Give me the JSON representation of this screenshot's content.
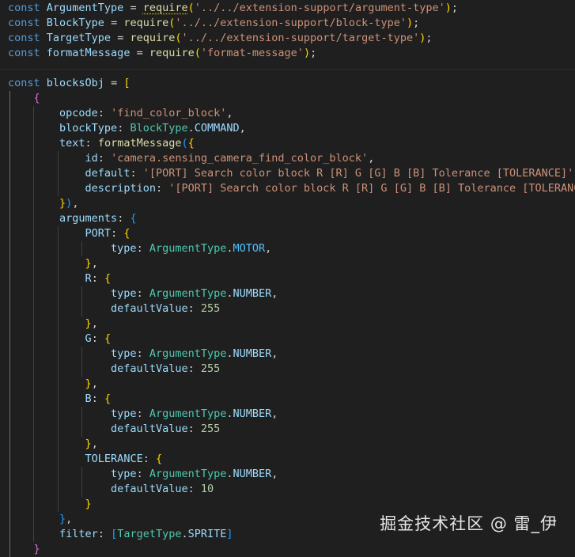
{
  "lines": [
    [
      [
        "kw",
        "const "
      ],
      [
        "var",
        "ArgumentType"
      ],
      [
        "op",
        " = "
      ],
      [
        "fn",
        "require",
        "squig"
      ],
      [
        "b1",
        "("
      ],
      [
        "str",
        "'../../extension-support/argument-type'"
      ],
      [
        "b1",
        ")"
      ],
      [
        "punc",
        ";"
      ]
    ],
    [
      [
        "kw",
        "const "
      ],
      [
        "var",
        "BlockType"
      ],
      [
        "op",
        " = "
      ],
      [
        "fn",
        "require"
      ],
      [
        "b1",
        "("
      ],
      [
        "str",
        "'../../extension-support/block-type'"
      ],
      [
        "b1",
        ")"
      ],
      [
        "punc",
        ";"
      ]
    ],
    [
      [
        "kw",
        "const "
      ],
      [
        "var",
        "TargetType"
      ],
      [
        "op",
        " = "
      ],
      [
        "fn",
        "require"
      ],
      [
        "b1",
        "("
      ],
      [
        "str",
        "'../../extension-support/target-type'"
      ],
      [
        "b1",
        ")"
      ],
      [
        "punc",
        ";"
      ]
    ],
    [
      [
        "kw",
        "const "
      ],
      [
        "var",
        "formatMessage"
      ],
      [
        "op",
        " = "
      ],
      [
        "fn",
        "require"
      ],
      [
        "b1",
        "("
      ],
      [
        "str",
        "'format-message'"
      ],
      [
        "b1",
        ")"
      ],
      [
        "punc",
        ";"
      ]
    ],
    [],
    [
      [
        "kw",
        "const "
      ],
      [
        "var",
        "blocksObj"
      ],
      [
        "op",
        " = "
      ],
      [
        "b1",
        "["
      ]
    ],
    [
      [
        "op",
        "    "
      ],
      [
        "b2",
        "{"
      ]
    ],
    [
      [
        "op",
        "        "
      ],
      [
        "prop",
        "opcode"
      ],
      [
        "punc",
        ": "
      ],
      [
        "str",
        "'find_color_block'"
      ],
      [
        "punc",
        ","
      ]
    ],
    [
      [
        "op",
        "        "
      ],
      [
        "prop",
        "blockType"
      ],
      [
        "punc",
        ": "
      ],
      [
        "type",
        "BlockType"
      ],
      [
        "punc",
        "."
      ],
      [
        "prop",
        "COMMAND"
      ],
      [
        "punc",
        ","
      ]
    ],
    [
      [
        "op",
        "        "
      ],
      [
        "prop",
        "text"
      ],
      [
        "punc",
        ": "
      ],
      [
        "fn",
        "formatMessage"
      ],
      [
        "b3",
        "("
      ],
      [
        "b1",
        "{"
      ]
    ],
    [
      [
        "op",
        "            "
      ],
      [
        "prop",
        "id"
      ],
      [
        "punc",
        ": "
      ],
      [
        "str",
        "'camera.sensing_camera_find_color_block'"
      ],
      [
        "punc",
        ","
      ]
    ],
    [
      [
        "op",
        "            "
      ],
      [
        "prop",
        "default"
      ],
      [
        "punc",
        ": "
      ],
      [
        "str",
        "'[PORT] Search color block R [R] G [G] B [B] Tolerance [TOLERANCE]'"
      ],
      [
        "punc",
        ","
      ]
    ],
    [
      [
        "op",
        "            "
      ],
      [
        "prop",
        "description"
      ],
      [
        "punc",
        ": "
      ],
      [
        "str",
        "'[PORT] Search color block R [R] G [G] B [B] Tolerance [TOLERANCE]'"
      ]
    ],
    [
      [
        "op",
        "        "
      ],
      [
        "b1",
        "}"
      ],
      [
        "b3",
        ")"
      ],
      [
        "punc",
        ","
      ]
    ],
    [
      [
        "op",
        "        "
      ],
      [
        "prop",
        "arguments"
      ],
      [
        "punc",
        ": "
      ],
      [
        "b3",
        "{"
      ]
    ],
    [
      [
        "op",
        "            "
      ],
      [
        "prop",
        "PORT"
      ],
      [
        "punc",
        ": "
      ],
      [
        "b1",
        "{"
      ]
    ],
    [
      [
        "op",
        "                "
      ],
      [
        "prop",
        "type"
      ],
      [
        "punc",
        ": "
      ],
      [
        "type",
        "ArgumentType"
      ],
      [
        "punc",
        "."
      ],
      [
        "const",
        "MOTOR"
      ],
      [
        "punc",
        ","
      ]
    ],
    [
      [
        "op",
        "            "
      ],
      [
        "b1",
        "}"
      ],
      [
        "punc",
        ","
      ]
    ],
    [
      [
        "op",
        "            "
      ],
      [
        "prop",
        "R"
      ],
      [
        "punc",
        ": "
      ],
      [
        "b1",
        "{"
      ]
    ],
    [
      [
        "op",
        "                "
      ],
      [
        "prop",
        "type"
      ],
      [
        "punc",
        ": "
      ],
      [
        "type",
        "ArgumentType"
      ],
      [
        "punc",
        "."
      ],
      [
        "prop",
        "NUMBER"
      ],
      [
        "punc",
        ","
      ]
    ],
    [
      [
        "op",
        "                "
      ],
      [
        "prop",
        "defaultValue"
      ],
      [
        "punc",
        ": "
      ],
      [
        "num",
        "255"
      ]
    ],
    [
      [
        "op",
        "            "
      ],
      [
        "b1",
        "}"
      ],
      [
        "punc",
        ","
      ]
    ],
    [
      [
        "op",
        "            "
      ],
      [
        "prop",
        "G"
      ],
      [
        "punc",
        ": "
      ],
      [
        "b1",
        "{"
      ]
    ],
    [
      [
        "op",
        "                "
      ],
      [
        "prop",
        "type"
      ],
      [
        "punc",
        ": "
      ],
      [
        "type",
        "ArgumentType"
      ],
      [
        "punc",
        "."
      ],
      [
        "prop",
        "NUMBER"
      ],
      [
        "punc",
        ","
      ]
    ],
    [
      [
        "op",
        "                "
      ],
      [
        "prop",
        "defaultValue"
      ],
      [
        "punc",
        ": "
      ],
      [
        "num",
        "255"
      ]
    ],
    [
      [
        "op",
        "            "
      ],
      [
        "b1",
        "}"
      ],
      [
        "punc",
        ","
      ]
    ],
    [
      [
        "op",
        "            "
      ],
      [
        "prop",
        "B"
      ],
      [
        "punc",
        ": "
      ],
      [
        "b1",
        "{"
      ]
    ],
    [
      [
        "op",
        "                "
      ],
      [
        "prop",
        "type"
      ],
      [
        "punc",
        ": "
      ],
      [
        "type",
        "ArgumentType"
      ],
      [
        "punc",
        "."
      ],
      [
        "prop",
        "NUMBER"
      ],
      [
        "punc",
        ","
      ]
    ],
    [
      [
        "op",
        "                "
      ],
      [
        "prop",
        "defaultValue"
      ],
      [
        "punc",
        ": "
      ],
      [
        "num",
        "255"
      ]
    ],
    [
      [
        "op",
        "            "
      ],
      [
        "b1",
        "}"
      ],
      [
        "punc",
        ","
      ]
    ],
    [
      [
        "op",
        "            "
      ],
      [
        "prop",
        "TOLERANCE"
      ],
      [
        "punc",
        ": "
      ],
      [
        "b1",
        "{"
      ]
    ],
    [
      [
        "op",
        "                "
      ],
      [
        "prop",
        "type"
      ],
      [
        "punc",
        ": "
      ],
      [
        "type",
        "ArgumentType"
      ],
      [
        "punc",
        "."
      ],
      [
        "prop",
        "NUMBER"
      ],
      [
        "punc",
        ","
      ]
    ],
    [
      [
        "op",
        "                "
      ],
      [
        "prop",
        "defaultValue"
      ],
      [
        "punc",
        ": "
      ],
      [
        "num",
        "10"
      ]
    ],
    [
      [
        "op",
        "            "
      ],
      [
        "b1",
        "}"
      ]
    ],
    [
      [
        "op",
        "        "
      ],
      [
        "b3",
        "}"
      ],
      [
        "punc",
        ","
      ]
    ],
    [
      [
        "op",
        "        "
      ],
      [
        "prop",
        "filter"
      ],
      [
        "punc",
        ": "
      ],
      [
        "b3",
        "["
      ],
      [
        "type",
        "TargetType"
      ],
      [
        "punc",
        "."
      ],
      [
        "prop",
        "SPRITE"
      ],
      [
        "b3",
        "]"
      ]
    ],
    [
      [
        "op",
        "    "
      ],
      [
        "b2",
        "}"
      ]
    ]
  ],
  "watermark": "掘金技术社区 @ 雷_伊"
}
